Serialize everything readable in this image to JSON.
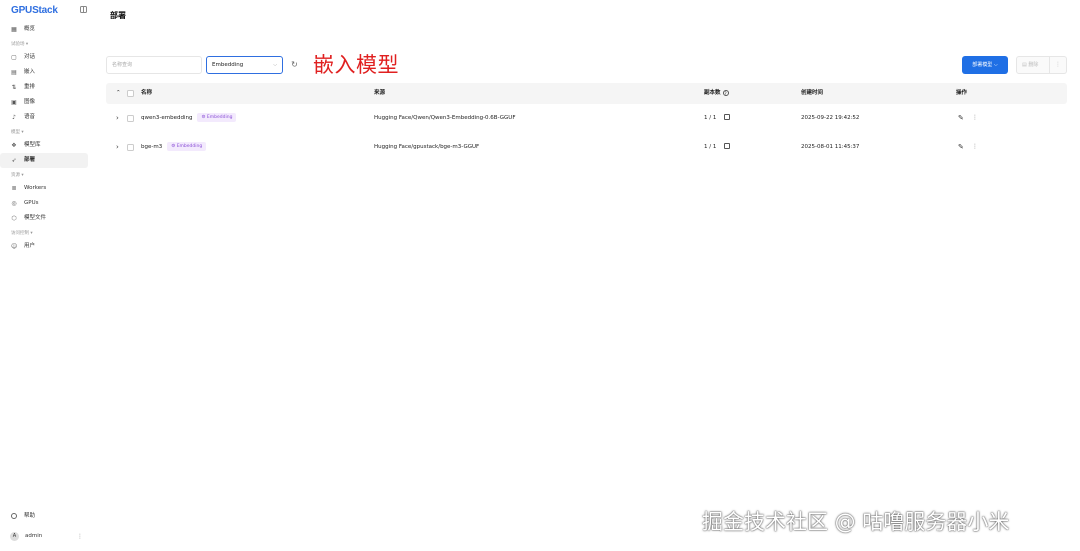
{
  "app": {
    "logo_text": "GPUStack"
  },
  "sidebar": {
    "groups": [
      {
        "label": "试验场 ▾",
        "items": [
          {
            "label": "对话",
            "icon": "chat-icon"
          },
          {
            "label": "嵌入",
            "icon": "embed-icon"
          },
          {
            "label": "重排",
            "icon": "rerank-icon"
          },
          {
            "label": "图像",
            "icon": "image-icon"
          },
          {
            "label": "语音",
            "icon": "audio-icon"
          }
        ]
      },
      {
        "label": "模型 ▾",
        "items": [
          {
            "label": "模型库",
            "icon": "model-library-icon"
          },
          {
            "label": "部署",
            "icon": "deploy-icon",
            "active": true
          }
        ]
      },
      {
        "label": "资源 ▾",
        "items": [
          {
            "label": "Workers",
            "icon": "server-icon"
          },
          {
            "label": "GPUs",
            "icon": "gpu-icon"
          },
          {
            "label": "模型文件",
            "icon": "model-files-icon"
          }
        ]
      },
      {
        "label": "访问控制 ▾",
        "items": [
          {
            "label": "用户",
            "icon": "users-icon"
          }
        ]
      }
    ],
    "overview_label": "概览",
    "help_label": "帮助",
    "user": {
      "name": "admin",
      "avatar": "A"
    }
  },
  "page": {
    "title": "部署"
  },
  "toolbar": {
    "search_placeholder": "名称查询",
    "category_value": "Embedding",
    "annotation": "嵌入模型",
    "deploy_button": "部署模型",
    "delete_button": "删除"
  },
  "table": {
    "headers": {
      "name": "名称",
      "source": "来源",
      "replicas": "副本数",
      "created": "创建时间",
      "actions": "操作"
    },
    "rows": [
      {
        "name": "qwen3-embedding",
        "tag": "Embedding",
        "source": "Hugging Face/Qwen/Qwen3-Embedding-0.6B-GGUF",
        "replicas": "1 / 1",
        "created": "2025-09-22 19:42:52"
      },
      {
        "name": "bge-m3",
        "tag": "Embedding",
        "source": "Hugging Face/gpustack/bge-m3-GGUF",
        "replicas": "1 / 1",
        "created": "2025-08-01 11:45:37"
      }
    ]
  },
  "watermark": "掘金技术社区 @ 咕噜服务器小米",
  "colors": {
    "primary": "#1f6fe5",
    "tag_bg": "#f3eafd",
    "tag_text": "#8a4fd6",
    "annotation": "#e02020"
  }
}
